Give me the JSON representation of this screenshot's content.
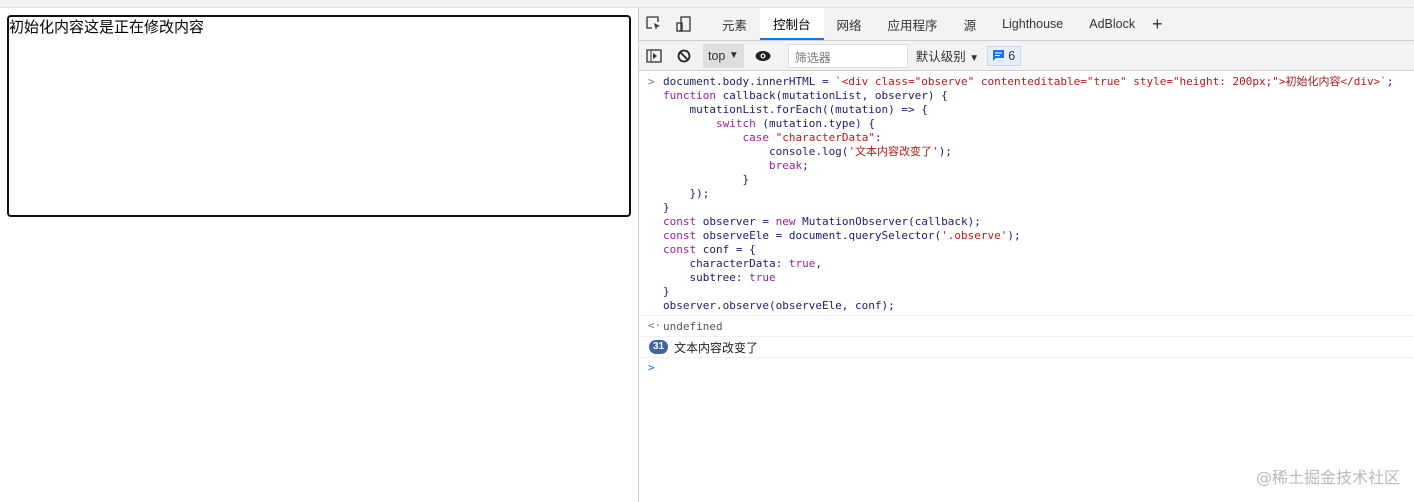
{
  "page": {
    "observe_text": "初始化内容这是正在修改内容"
  },
  "devtools": {
    "tabs": [
      "元素",
      "控制台",
      "网络",
      "应用程序",
      "源",
      "Lighthouse",
      "AdBlock"
    ],
    "active_tab": 1,
    "toolbar": {
      "context": "top",
      "filter_placeholder": "筛选器",
      "level": "默认级别",
      "message_count": "6"
    },
    "code_lines": [
      [
        [
          "document.body.innerHTML = ",
          ""
        ],
        [
          "`<div class=\"observe\" contenteditable=\"true\" style=\"height: 200px;\">",
          "s"
        ],
        [
          "初始化内容",
          "z"
        ],
        [
          "</div>`",
          "s"
        ],
        [
          ";",
          ""
        ]
      ],
      [
        [
          "function",
          "k"
        ],
        [
          " callback(mutationList, observer) {",
          ""
        ]
      ],
      [
        [
          "    mutationList.forEach((mutation) => {",
          ""
        ]
      ],
      [
        [
          "        ",
          ""
        ],
        [
          "switch",
          "k"
        ],
        [
          " (mutation.type) {",
          ""
        ]
      ],
      [
        [
          "            ",
          ""
        ],
        [
          "case",
          "k"
        ],
        [
          " ",
          ""
        ],
        [
          "\"characterData\"",
          "s"
        ],
        [
          ":",
          ""
        ]
      ],
      [
        [
          "                console.log(",
          ""
        ],
        [
          "'文本内容改变了'",
          "s"
        ],
        [
          ");",
          ""
        ]
      ],
      [
        [
          "                ",
          ""
        ],
        [
          "break",
          "k"
        ],
        [
          ";",
          ""
        ]
      ],
      [
        [
          "            }",
          ""
        ]
      ],
      [
        [
          "    });",
          ""
        ]
      ],
      [
        [
          "}",
          ""
        ]
      ],
      [
        [
          "const",
          "k"
        ],
        [
          " observer = ",
          ""
        ],
        [
          "new",
          "k"
        ],
        [
          " MutationObserver(callback);",
          ""
        ]
      ],
      [
        [
          "const",
          "k"
        ],
        [
          " observeEle = document.querySelector(",
          ""
        ],
        [
          "'.observe'",
          "s"
        ],
        [
          ");",
          ""
        ]
      ],
      [
        [
          "const",
          "k"
        ],
        [
          " conf = {",
          ""
        ]
      ],
      [
        [
          "    characterData: ",
          ""
        ],
        [
          "true",
          "k"
        ],
        [
          ",",
          ""
        ]
      ],
      [
        [
          "    subtree: ",
          ""
        ],
        [
          "true",
          "k"
        ]
      ],
      [
        [
          "}",
          ""
        ]
      ],
      [
        [
          "observer.observe(observeEle, conf);",
          ""
        ]
      ]
    ],
    "result": "undefined",
    "log": {
      "count": "31",
      "text": "文本内容改变了"
    }
  },
  "watermark": "@稀土掘金技术社区"
}
